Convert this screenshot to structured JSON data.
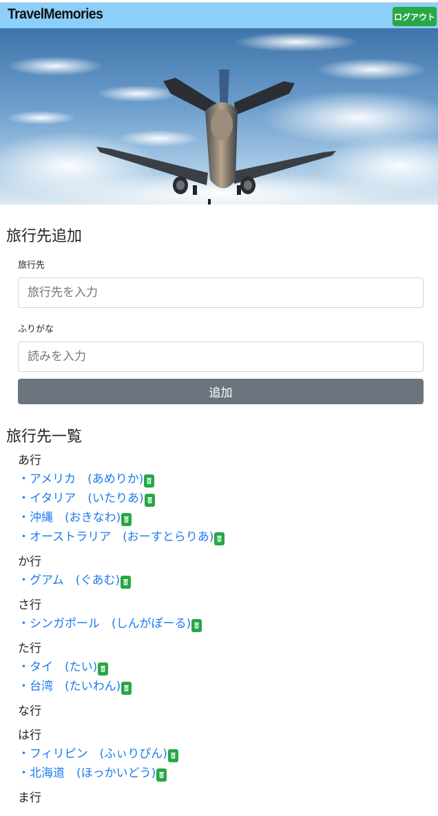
{
  "header": {
    "brand": "TravelMemories",
    "logout_label": "ログアウト",
    "bg_color": "#8ccff8",
    "logout_color": "#28a745"
  },
  "hero": {
    "image": "airplane-in-sky"
  },
  "add_section": {
    "title": "旅行先追加",
    "destination_label": "旅行先",
    "destination_placeholder": "旅行先を入力",
    "reading_label": "ふりがな",
    "reading_placeholder": "読みを入力",
    "submit_label": "追加"
  },
  "list_section": {
    "title": "旅行先一覧",
    "delete_icon": "trash-icon",
    "groups": [
      {
        "label": "あ行",
        "items": [
          "・アメリカ　(あめりか)",
          "・イタリア　(いたりあ)",
          "・沖縄　(おきなわ)",
          "・オーストラリア　(おーすとらりあ)"
        ]
      },
      {
        "label": "か行",
        "items": [
          "・グアム　(ぐあむ)"
        ]
      },
      {
        "label": "さ行",
        "items": [
          "・シンガポール　(しんがぽーる)"
        ]
      },
      {
        "label": "た行",
        "items": [
          "・タイ　(たい)",
          "・台湾　(たいわん)"
        ]
      },
      {
        "label": "な行",
        "items": []
      },
      {
        "label": "は行",
        "items": [
          "・フィリピン　(ふぃりぴん)",
          "・北海道　(ほっかいどう)"
        ]
      },
      {
        "label": "ま行",
        "items": []
      }
    ]
  }
}
